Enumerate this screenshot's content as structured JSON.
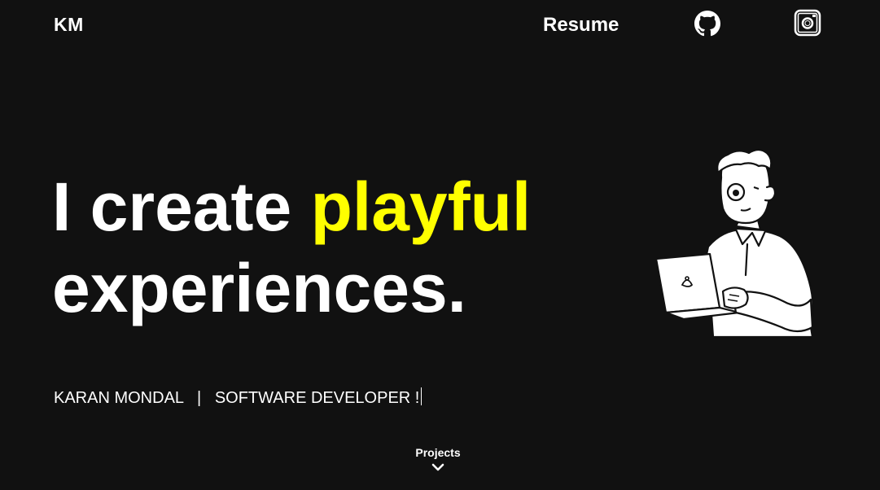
{
  "nav": {
    "logo": "KM",
    "resume_label": "Resume",
    "github_icon": "github-icon",
    "instagram_icon": "instagram-icon"
  },
  "hero": {
    "headline_word1": "I create",
    "headline_accent": "playful",
    "headline_line2": "experiences.",
    "subtitle": "KARAN MONDAL   |   SOFTWARE DEVELOPER !",
    "accent_color": "#ffff00",
    "background_color": "#111111"
  },
  "scroll": {
    "label": "Projects",
    "icon": "chevron-down-icon"
  },
  "illustration": {
    "icon": "developer-with-laptop-illustration"
  }
}
